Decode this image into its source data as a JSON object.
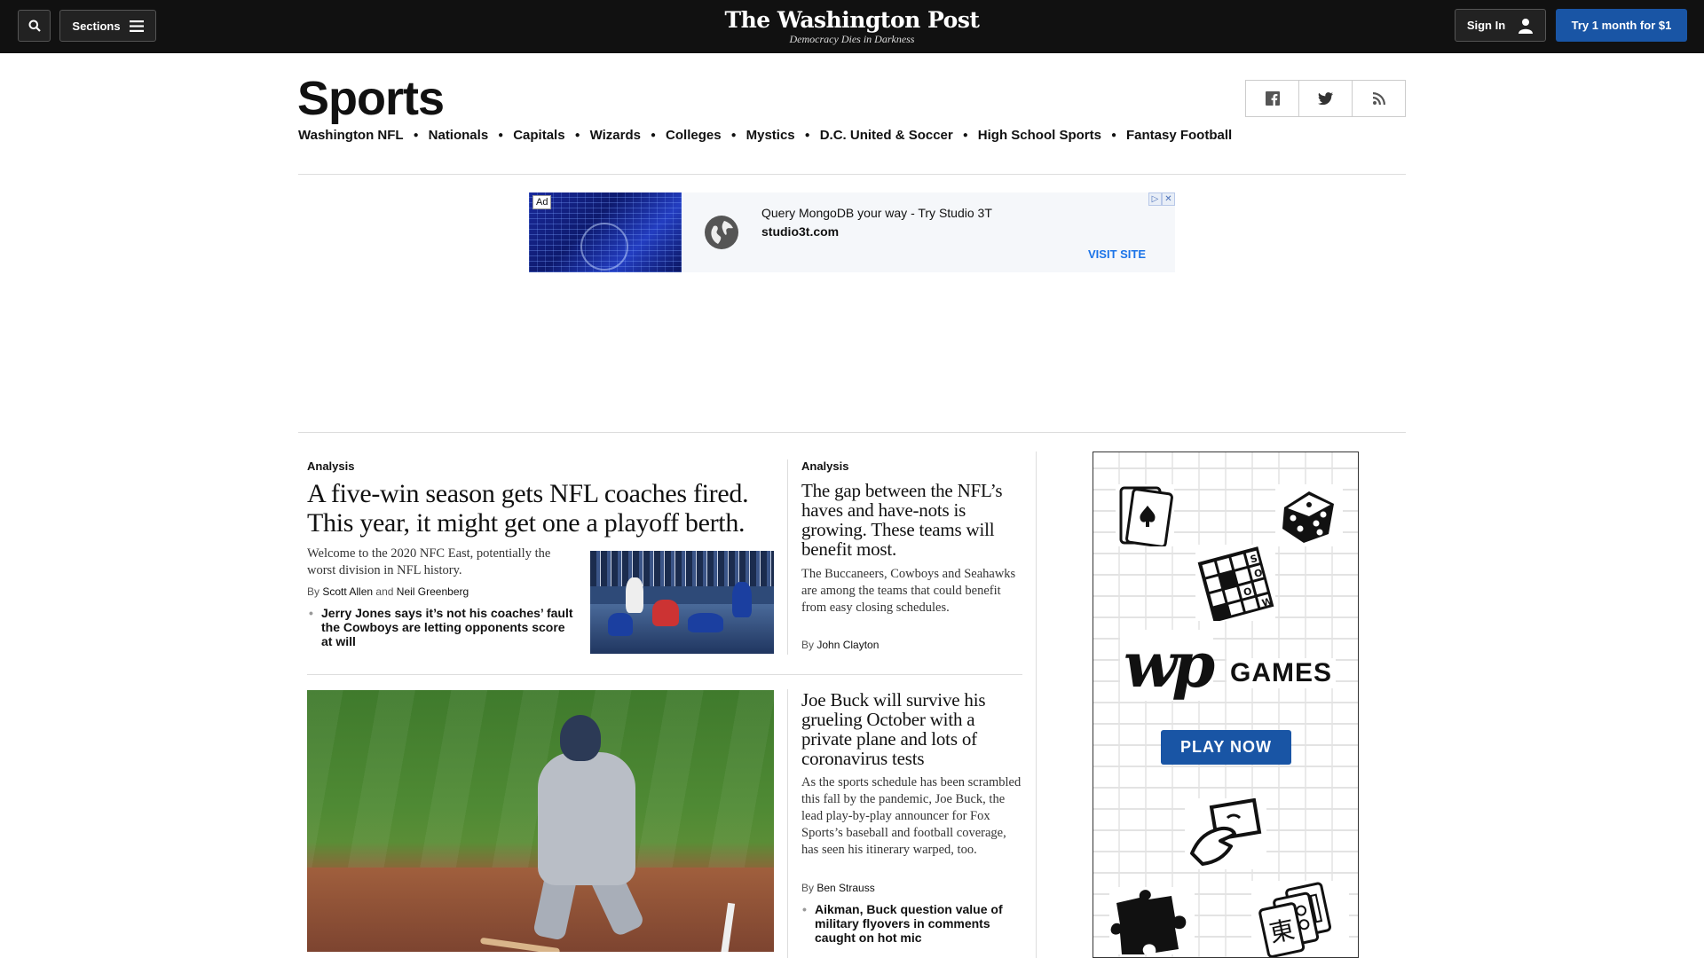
{
  "header": {
    "sections_label": "Sections",
    "logo": "The Washington Post",
    "tagline": "Democracy Dies in Darkness",
    "signin_label": "Sign In",
    "subscribe_label": "Try 1 month for $1"
  },
  "section": {
    "title": "Sports",
    "nav": [
      "Washington NFL",
      "Nationals",
      "Capitals",
      "Wizards",
      "Colleges",
      "Mystics",
      "D.C. United & Soccer",
      "High School Sports",
      "Fantasy Football"
    ]
  },
  "ad": {
    "badge": "Ad",
    "headline": "Query MongoDB your way - Try Studio 3T",
    "domain": "studio3t.com",
    "cta": "VISIT SITE"
  },
  "stories": {
    "lead": {
      "label": "Analysis",
      "headline": "A five-win season gets NFL coaches fired. This year, it might get one a playoff berth.",
      "blurb": "Welcome to the 2020 NFC East, potentially the worst division in NFL history.",
      "by": "By",
      "author1": "Scott Allen",
      "and": "and",
      "author2": "Neil Greenberg",
      "related": "Jerry Jones says it’s not his coaches’ fault the Cowboys are letting opponents score at will"
    },
    "second": {
      "label": "Analysis",
      "headline": "The gap between the NFL’s haves and have-nots is growing. These teams will benefit most.",
      "blurb": "The Buccaneers, Cowboys and Seahawks are among the teams that could benefit from easy closing schedules.",
      "by": "By",
      "author": "John Clayton"
    },
    "third": {
      "headline": "Joe Buck will survive his grueling October with a private plane and lots of coronavirus tests",
      "blurb": "As the sports schedule has been scrambled this fall by the pandemic, Joe Buck, the lead play-by-play announcer for Fox Sports’s baseball and football coverage, has seen his itinerary warped, too.",
      "by": "By",
      "author": "Ben Strauss",
      "related": "Aikman, Buck question value of military flyovers in comments caught on hot mic"
    }
  },
  "games_ad": {
    "wordmark": "wp",
    "games_label": "GAMES",
    "cta": "PLAY NOW"
  },
  "colors": {
    "topbar": "#111111",
    "accent_blue": "#1955a5"
  }
}
